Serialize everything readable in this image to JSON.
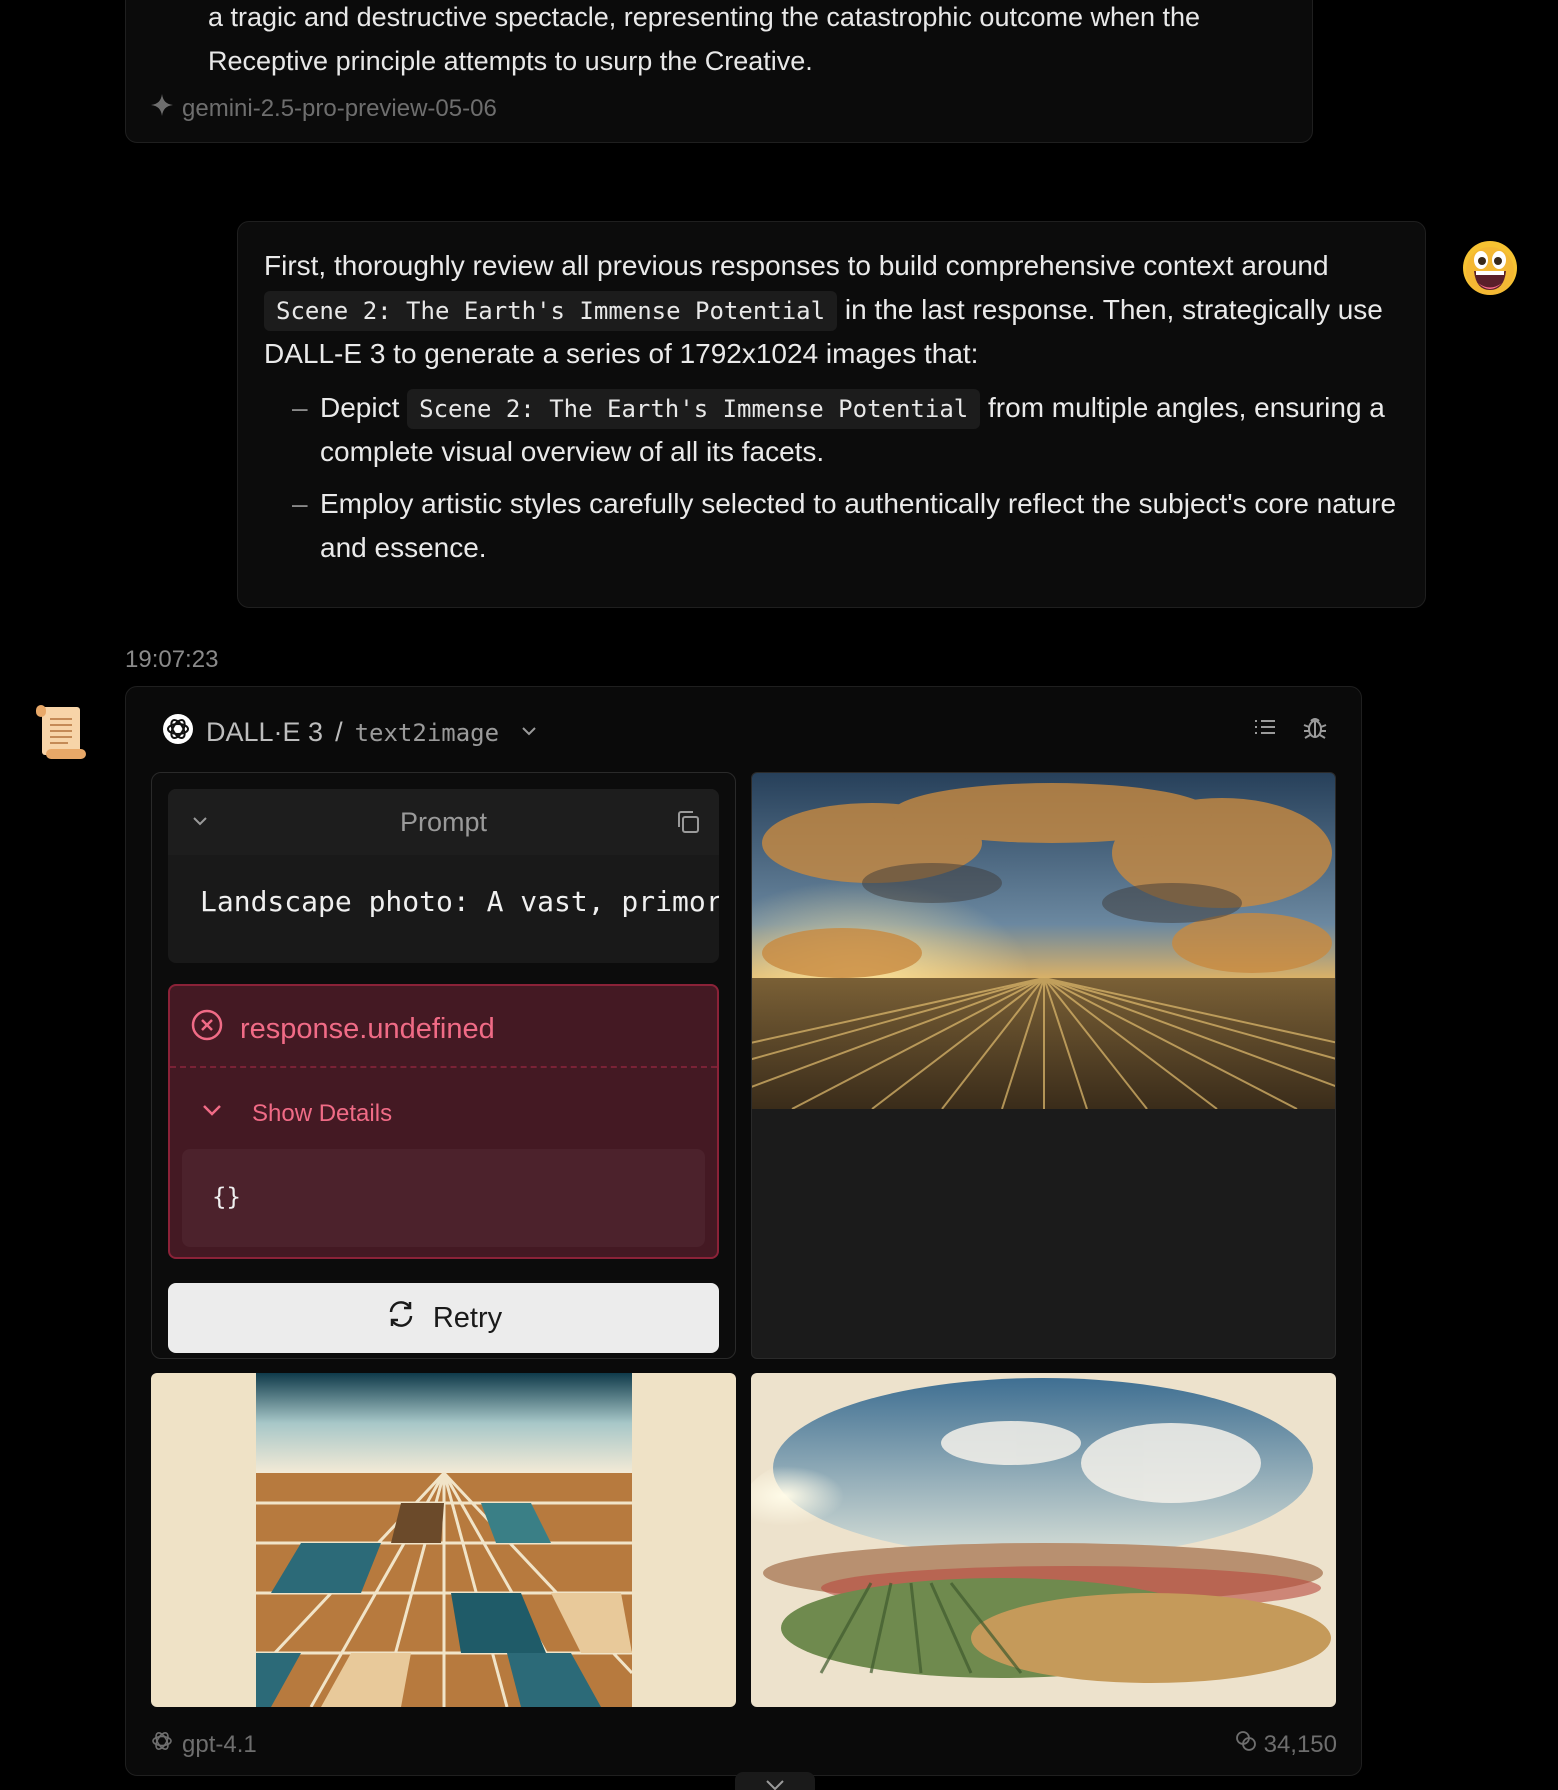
{
  "previous_message": {
    "text_line1": "a tragic and destructive spectacle, representing the catastrophic outcome when the",
    "text_line2": "Receptive principle attempts to usurp the Creative.",
    "model": "gemini-2.5-pro-preview-05-06"
  },
  "user_message": {
    "p1_a": "First, thoroughly review all previous responses to build comprehensive context around",
    "p1_code": "Scene 2: The Earth's Immense Potential",
    "p1_b": "in the last response. Then, strategically use DALL-E 3 to generate a series of 1792x1024 images that:",
    "item1_a": "Depict",
    "item1_code": "Scene 2: The Earth's Immense Potential",
    "item1_b": "from multiple angles, ensuring a complete visual overview of all its facets.",
    "item2": "Employ artistic styles carefully selected to authentically reflect the subject's core nature and essence."
  },
  "assistant": {
    "timestamp": "19:07:23",
    "plugin_name": "DALL·E 3",
    "separator": "/",
    "plugin_api": "text2image",
    "prompt_label": "Prompt",
    "prompt_text": "Landscape photo: A vast, primordial",
    "error_title": "response.undefined",
    "error_toggle": "Show Details",
    "error_detail": "{}",
    "retry_label": "Retry",
    "model": "gpt-4.1",
    "tokens": "34,150"
  },
  "colors": {
    "error_text": "#f06b86",
    "error_bg": "#441923",
    "error_border": "#8b2238"
  }
}
